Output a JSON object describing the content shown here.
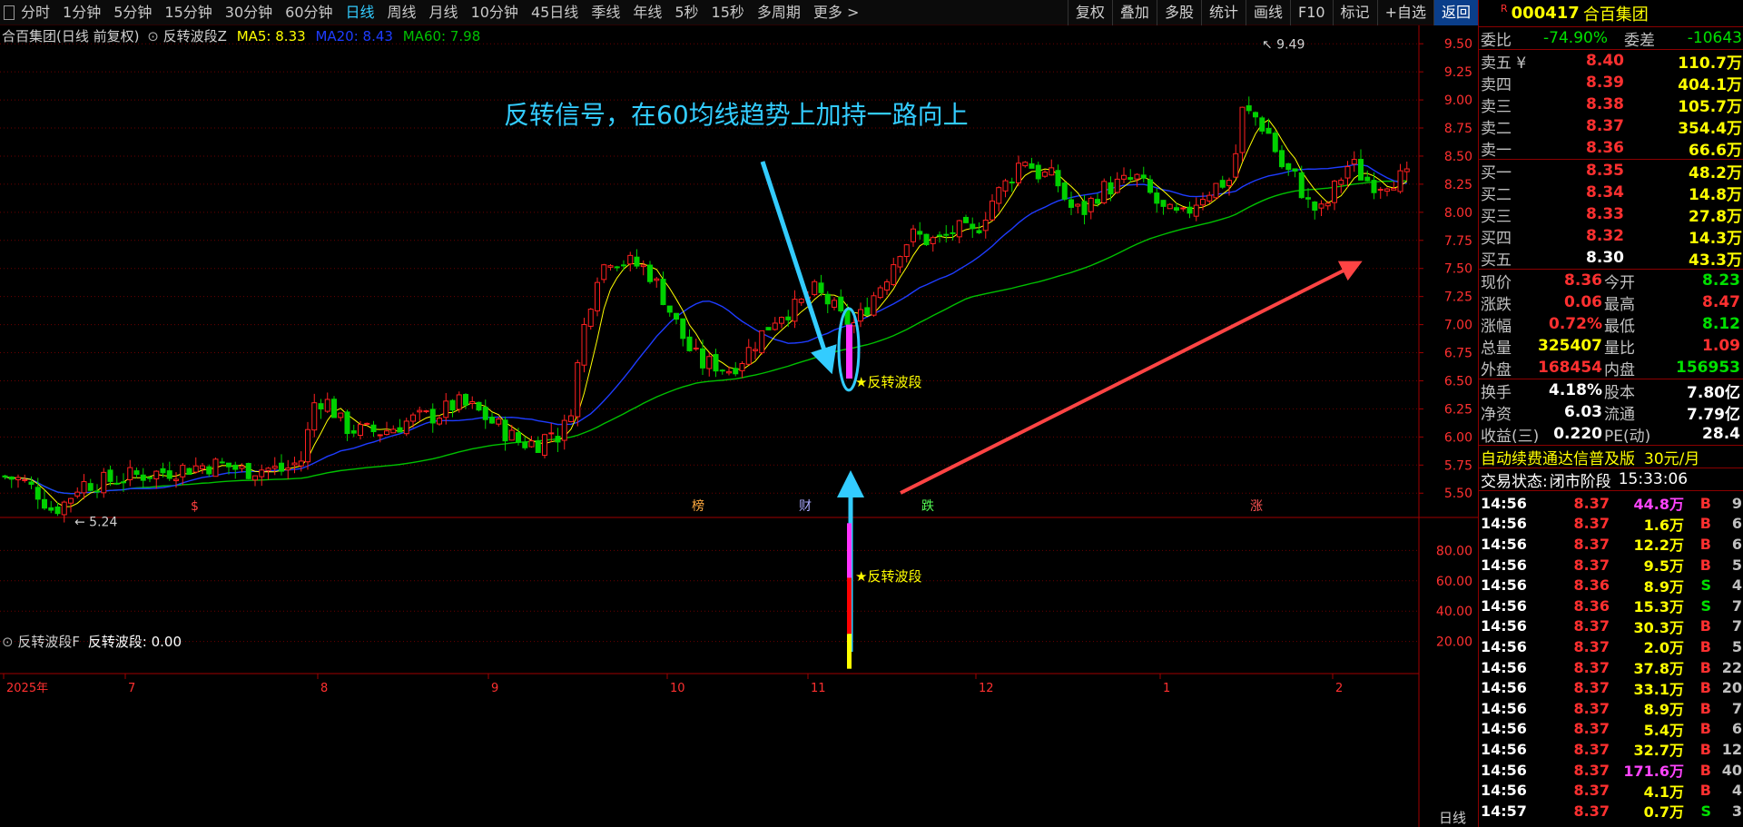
{
  "toolbar": {
    "periods": [
      "分时",
      "1分钟",
      "5分钟",
      "15分钟",
      "30分钟",
      "60分钟",
      "日线",
      "周线",
      "月线",
      "10分钟",
      "45日线",
      "季线",
      "年线",
      "5秒",
      "15秒",
      "多周期",
      "更多 >"
    ],
    "active": "日线",
    "tools": [
      "复权",
      "叠加",
      "多股",
      "统计",
      "画线",
      "F10",
      "标记",
      "+自选",
      "返回"
    ]
  },
  "stock": {
    "title": "合百集团(日线 前复权)",
    "indicator": "反转波段Z",
    "ma5": "MA5: 8.33",
    "ma20": "MA20: 8.43",
    "ma60": "MA60: 7.98"
  },
  "sub_indicator": {
    "name": "反转波段F",
    "value": "反转波段: 0.00"
  },
  "annotation": "反转信号，在60均线趋势上加持一路向上",
  "signal_label": "★反转波段",
  "axis": {
    "main_ticks": [
      "9.50",
      "9.25",
      "9.00",
      "8.75",
      "8.50",
      "8.25",
      "8.00",
      "7.75",
      "7.50",
      "7.25",
      "7.00",
      "6.75",
      "6.50",
      "6.25",
      "6.00",
      "5.75",
      "5.50"
    ],
    "sub_ticks": [
      "80.00",
      "60.00",
      "40.00",
      "20.00"
    ],
    "x_labels": [
      "2025年",
      "7",
      "8",
      "9",
      "10",
      "11",
      "12",
      "1",
      "2"
    ],
    "extreme_high": "9.49",
    "extreme_low": "5.24"
  },
  "events": [
    "$",
    "榜",
    "财",
    "跌",
    "涨"
  ],
  "quote": {
    "code_prefix": "R",
    "code": "000417",
    "name": "合百集团",
    "weibi": "委比",
    "weibi_val": "-74.90%",
    "weicha": "委差",
    "weicha_val": "-10643",
    "sells": [
      {
        "label": "卖五 ¥",
        "price": "8.40",
        "vol": "110.7万"
      },
      {
        "label": "卖四",
        "price": "8.39",
        "vol": "404.1万"
      },
      {
        "label": "卖三",
        "price": "8.38",
        "vol": "105.7万"
      },
      {
        "label": "卖二",
        "price": "8.37",
        "vol": "354.4万"
      },
      {
        "label": "卖一",
        "price": "8.36",
        "vol": "66.6万"
      }
    ],
    "buys": [
      {
        "label": "买一",
        "price": "8.35",
        "vol": "48.2万"
      },
      {
        "label": "买二",
        "price": "8.34",
        "vol": "14.8万"
      },
      {
        "label": "买三",
        "price": "8.33",
        "vol": "27.8万"
      },
      {
        "label": "买四",
        "price": "8.32",
        "vol": "14.3万"
      },
      {
        "label": "买五",
        "price": "8.30",
        "vol": "43.3万"
      }
    ],
    "stats": [
      [
        {
          "k": "现价",
          "v": "8.36"
        },
        {
          "k": "今开",
          "v": "8.23"
        }
      ],
      [
        {
          "k": "涨跌",
          "v": "0.06"
        },
        {
          "k": "最高",
          "v": "8.47"
        }
      ],
      [
        {
          "k": "涨幅",
          "v": "0.72%"
        },
        {
          "k": "最低",
          "v": "8.12"
        }
      ],
      [
        {
          "k": "总量",
          "v": "325407"
        },
        {
          "k": "量比",
          "v": "1.09"
        }
      ],
      [
        {
          "k": "外盘",
          "v": "168454"
        },
        {
          "k": "内盘",
          "v": "156953"
        }
      ]
    ],
    "stats2": [
      [
        {
          "k": "换手",
          "v": "4.18%"
        },
        {
          "k": "股本",
          "v": "7.80亿"
        }
      ],
      [
        {
          "k": "净资",
          "v": "6.03"
        },
        {
          "k": "流通",
          "v": "7.79亿"
        }
      ],
      [
        {
          "k": "收益(三)",
          "v": "0.220"
        },
        {
          "k": "PE(动)",
          "v": "28.4"
        }
      ]
    ],
    "promo": "自动续费通达信普及版",
    "promo_price": "30元/月",
    "status_label": "交易状态:",
    "status_val": "闭市阶段",
    "status_time": "15:33:06",
    "ticks": [
      [
        "14:56",
        "8.37",
        "44.8万",
        "B",
        "9"
      ],
      [
        "14:56",
        "8.37",
        "1.6万",
        "B",
        "6"
      ],
      [
        "14:56",
        "8.37",
        "12.2万",
        "B",
        "6"
      ],
      [
        "14:56",
        "8.37",
        "9.5万",
        "B",
        "5"
      ],
      [
        "14:56",
        "8.36",
        "8.9万",
        "S",
        "4"
      ],
      [
        "14:56",
        "8.36",
        "15.3万",
        "S",
        "7"
      ],
      [
        "14:56",
        "8.37",
        "30.3万",
        "B",
        "7"
      ],
      [
        "14:56",
        "8.37",
        "2.0万",
        "B",
        "5"
      ],
      [
        "14:56",
        "8.37",
        "37.8万",
        "B",
        "22"
      ],
      [
        "14:56",
        "8.37",
        "33.1万",
        "B",
        "20"
      ],
      [
        "14:56",
        "8.37",
        "8.9万",
        "B",
        "7"
      ],
      [
        "14:56",
        "8.37",
        "5.4万",
        "B",
        "6"
      ],
      [
        "14:56",
        "8.37",
        "32.7万",
        "B",
        "12"
      ],
      [
        "14:56",
        "8.37",
        "171.6万",
        "B",
        "40"
      ],
      [
        "14:56",
        "8.37",
        "4.1万",
        "B",
        "4"
      ],
      [
        "14:57",
        "8.37",
        "0.7万",
        "S",
        "3"
      ]
    ],
    "bottom_tab": "日线"
  },
  "colors": {
    "up": "#ff2020",
    "down": "#00d000",
    "ma5": "#ffff00",
    "ma20": "#1e3cff",
    "ma60": "#00c000",
    "accent": "#33ccff",
    "grid": "#6b0000"
  }
}
